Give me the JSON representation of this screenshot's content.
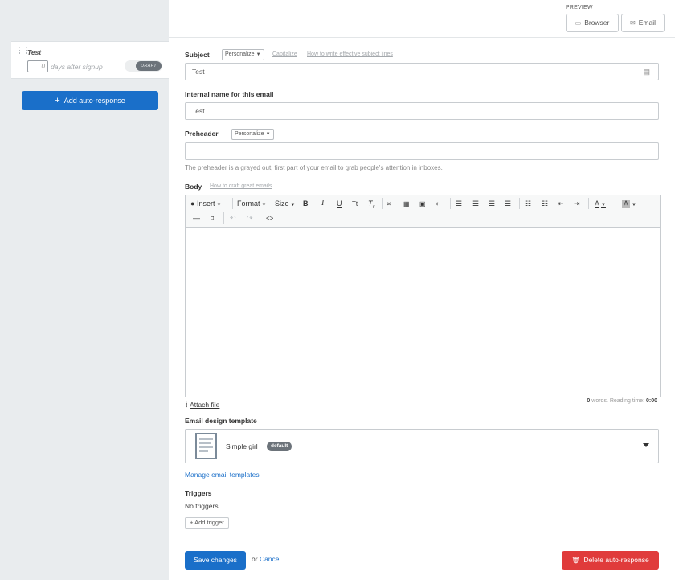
{
  "sidebar": {
    "autoresponse": {
      "title": "Test",
      "days_value": "0",
      "days_text": "days after signup",
      "status": "DRAFT"
    },
    "add_button": "Add auto-response"
  },
  "preview": {
    "label": "PREVIEW",
    "browser": "Browser",
    "email": "Email"
  },
  "subject": {
    "label": "Subject",
    "personalize": "Personalize",
    "capitalize": "Capitalize",
    "tips_link": "How to write effective subject lines",
    "value": "Test"
  },
  "internal_name": {
    "label": "Internal name for this email",
    "value": "Test"
  },
  "preheader": {
    "label": "Preheader",
    "personalize": "Personalize",
    "value": "",
    "help": "The preheader is a grayed out, first part of your email to grab people's attention in inboxes."
  },
  "body": {
    "label": "Body",
    "tips_link": "How to craft great emails",
    "toolbar": {
      "insert": "Insert",
      "format": "Format",
      "size": "Size"
    },
    "attach": "Attach file",
    "word_count": "0",
    "words_label": "words. Reading time:",
    "reading_time": "0:00"
  },
  "template": {
    "label": "Email design template",
    "name": "Simple girl",
    "badge": "default"
  },
  "manage_templates": "Manage email templates",
  "triggers": {
    "label": "Triggers",
    "empty": "No triggers.",
    "add": "Add trigger"
  },
  "actions": {
    "save": "Save changes",
    "or": "or",
    "cancel": "Cancel",
    "delete": "Delete auto-response"
  },
  "colors": {
    "primary": "#1a6fc9",
    "danger": "#e03b3b",
    "sidebar_bg": "#e9ecee",
    "badge": "#6c737a"
  }
}
